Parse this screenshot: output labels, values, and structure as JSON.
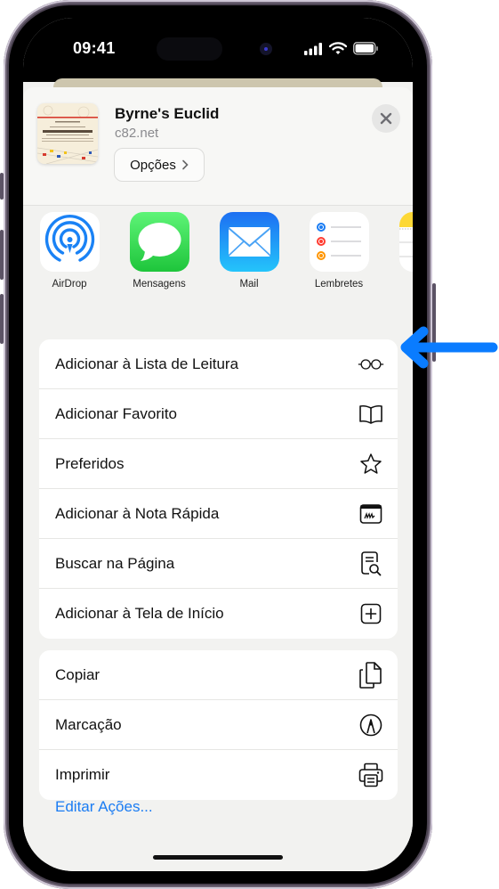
{
  "status_bar": {
    "time": "09:41",
    "icons": [
      "cellular-signal-icon",
      "wifi-icon",
      "battery-icon"
    ]
  },
  "share_sheet": {
    "page_title": "Byrne's Euclid",
    "page_domain": "c82.net",
    "options_label": "Opções",
    "thumbnail_text": {
      "small_heading": "BYRNE'S EUCLID",
      "title": "THE ELEMENTS OF EUCLID"
    },
    "close_icon": "close-icon",
    "apps": [
      {
        "label": "AirDrop",
        "icon": "airdrop-icon"
      },
      {
        "label": "Mensagens",
        "icon": "messages-icon"
      },
      {
        "label": "Mail",
        "icon": "mail-icon"
      },
      {
        "label": "Lembretes",
        "icon": "reminders-icon"
      },
      {
        "label": "",
        "icon": "notes-icon"
      }
    ],
    "action_groups": [
      [
        {
          "label": "Adicionar à Lista de Leitura",
          "icon": "glasses-icon"
        },
        {
          "label": "Adicionar Favorito",
          "icon": "book-icon"
        },
        {
          "label": "Preferidos",
          "icon": "star-icon"
        },
        {
          "label": "Adicionar à Nota Rápida",
          "icon": "quick-note-icon"
        },
        {
          "label": "Buscar na Página",
          "icon": "find-in-page-icon"
        },
        {
          "label": "Adicionar à Tela de Início",
          "icon": "add-square-icon"
        }
      ],
      [
        {
          "label": "Copiar",
          "icon": "copy-icon"
        },
        {
          "label": "Marcação",
          "icon": "markup-icon"
        },
        {
          "label": "Imprimir",
          "icon": "printer-icon"
        }
      ]
    ],
    "edit_actions_label": "Editar Ações..."
  },
  "callout": {
    "icon": "arrow-left-icon",
    "color": "#0a7cff",
    "points_to": "Adicionar à Lista de Leitura"
  },
  "colors": {
    "accent": "#1a7cf3",
    "messages_green": "#34c759",
    "mail_blue": "#1a8cff"
  }
}
